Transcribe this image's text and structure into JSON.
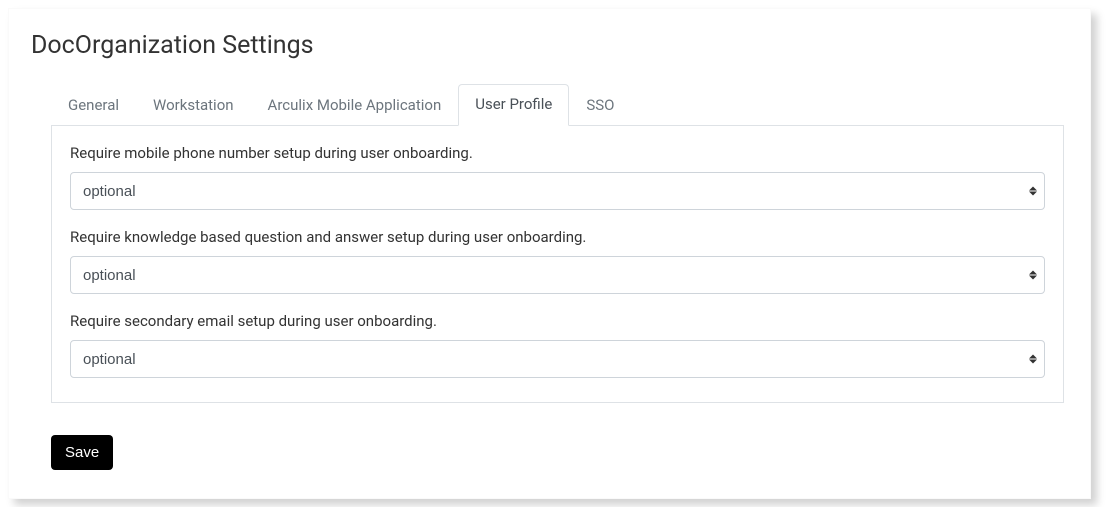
{
  "page_title": "DocOrganization Settings",
  "tabs": [
    {
      "label": "General",
      "active": false
    },
    {
      "label": "Workstation",
      "active": false
    },
    {
      "label": "Arculix Mobile Application",
      "active": false
    },
    {
      "label": "User Profile",
      "active": true
    },
    {
      "label": "SSO",
      "active": false
    }
  ],
  "fields": [
    {
      "label": "Require mobile phone number setup during user onboarding.",
      "value": "optional"
    },
    {
      "label": "Require knowledge based question and answer setup during user onboarding.",
      "value": "optional"
    },
    {
      "label": "Require secondary email setup during user onboarding.",
      "value": "optional"
    }
  ],
  "save_label": "Save"
}
